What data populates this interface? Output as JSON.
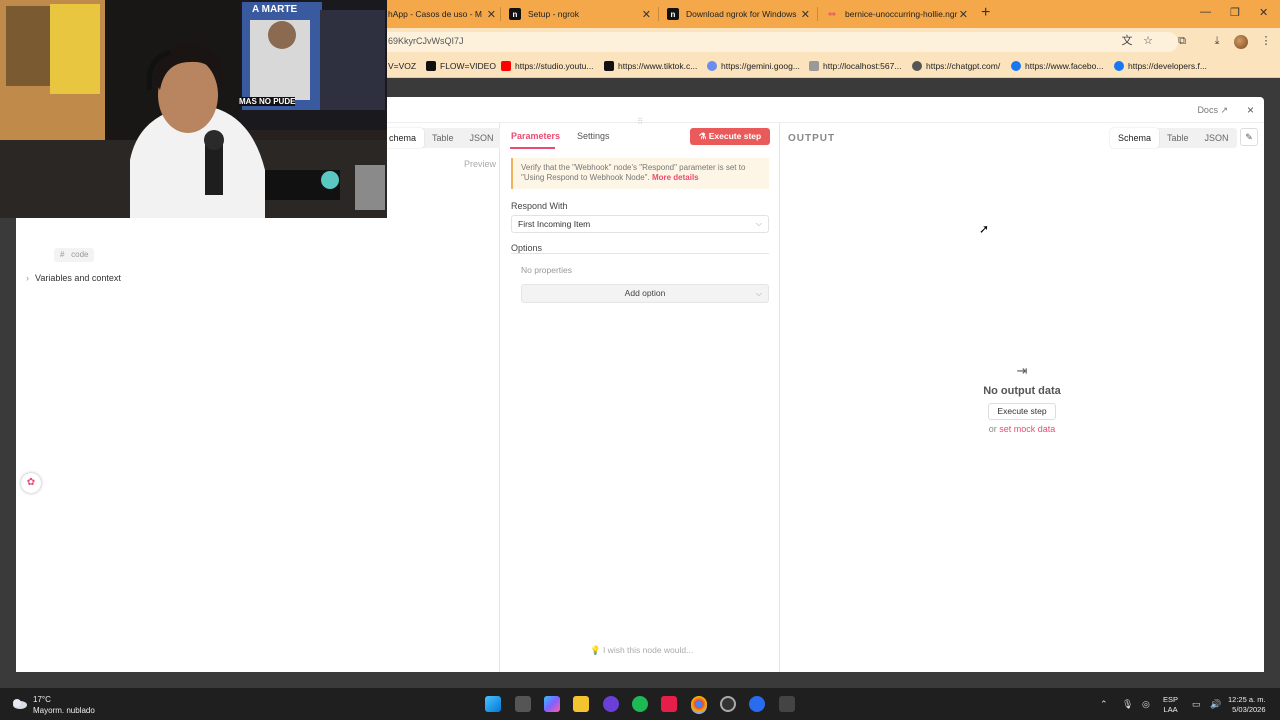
{
  "browser": {
    "tabs": [
      {
        "label": "hApp - Casos de uso - M",
        "icon": "globe-icon"
      },
      {
        "label": "Setup - ngrok",
        "icon": "ngrok-icon"
      },
      {
        "label": "Download ngrok for Windows",
        "icon": "ngrok-icon"
      },
      {
        "label": "bernice-unoccurring-hollie.ngr",
        "icon": "n8n-icon"
      }
    ],
    "new_tab": "+",
    "url": "69KkyrCJvWsQI7J",
    "bookmarks": [
      {
        "label": "V=VOZ",
        "color": "#ffffff"
      },
      {
        "label": "FLOW=VIDEO",
        "color": "#111111"
      },
      {
        "label": "https://studio.youtu...",
        "color": "#ff0000"
      },
      {
        "label": "https://www.tiktok.c...",
        "color": "#111111"
      },
      {
        "label": "https://gemini.goog...",
        "color": "#6a8cf0"
      },
      {
        "label": "http://localhost:567...",
        "color": "#777777"
      },
      {
        "label": "https://chatgpt.com/",
        "color": "#444444"
      },
      {
        "label": "https://www.facebo...",
        "color": "#1877f2"
      },
      {
        "label": "https://developers.f...",
        "color": "#1877f2"
      }
    ]
  },
  "modal": {
    "docs": "Docs",
    "close": "×"
  },
  "input_pane": {
    "views": [
      "chema",
      "Table",
      "JSON"
    ],
    "active_view": "chema",
    "preview": "Preview",
    "code_chip": "code",
    "variables": "Variables and context"
  },
  "params_pane": {
    "tabs": [
      "Parameters",
      "Settings"
    ],
    "execute_step": "Execute step",
    "notice_text": "Verify that the \"Webhook\" node's \"Respond\" parameter is set to \"Using Respond to Webhook Node\".",
    "notice_link": "More details",
    "respond_with_label": "Respond With",
    "respond_with_value": "First Incoming Item",
    "options_label": "Options",
    "no_properties": "No properties",
    "add_option": "Add option",
    "wish": "I wish this node would..."
  },
  "output_pane": {
    "title": "OUTPUT",
    "views": [
      "Schema",
      "Table",
      "JSON"
    ],
    "active_view": "Schema",
    "no_output": "No output data",
    "execute_step": "Execute step",
    "or": "or",
    "set_mock": "set mock data"
  },
  "webcam": {
    "poster_line1": "A MARTE",
    "poster_line2": "MAS NO PUDE"
  },
  "taskbar": {
    "temperature": "17°C",
    "weather": "Mayorm. nublado",
    "lang1": "ESP",
    "lang2": "LAA",
    "time": "12:25 a. m.",
    "date": "5/03/2026"
  },
  "colors": {
    "accent": "#ea4b71",
    "execute": "#ea5a5a",
    "chrome": "#f4a84a"
  }
}
